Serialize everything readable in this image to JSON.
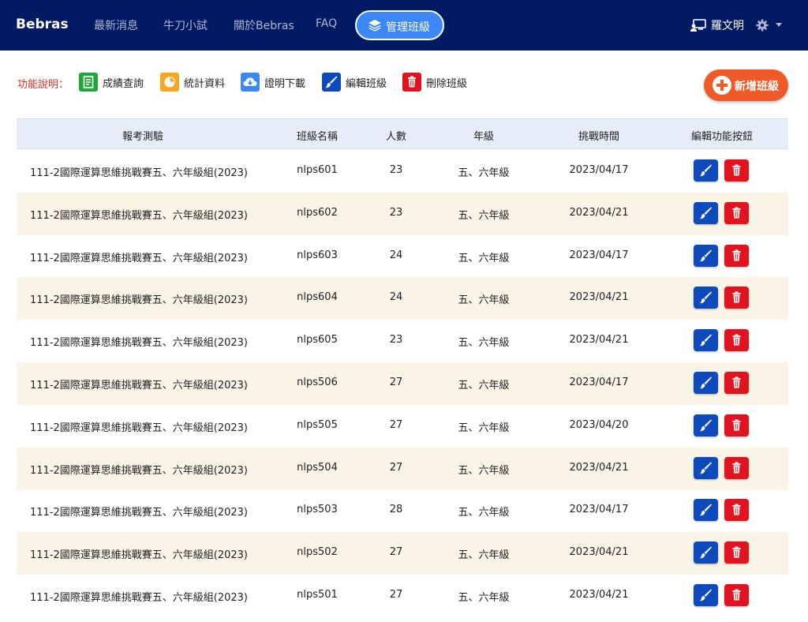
{
  "navbar": {
    "brand": "Bebras",
    "items": [
      {
        "label": "最新消息"
      },
      {
        "label": "牛刀小試"
      },
      {
        "label": "關於Bebras"
      },
      {
        "label": "FAQ"
      }
    ],
    "active_item": {
      "label": "管理班級",
      "icon": "layers-icon"
    },
    "user": {
      "name": "羅文明",
      "icon": "chalkboard-user-icon"
    },
    "settings_icon": "gear-icon"
  },
  "legend": {
    "label": "功能說明：",
    "items": [
      {
        "label": "成績查詢",
        "icon": "grade-sheet-icon",
        "color": "#22a83a"
      },
      {
        "label": "統計資料",
        "icon": "pie-chart-icon",
        "color": "#f6a823"
      },
      {
        "label": "證明下載",
        "icon": "cloud-download-icon",
        "color": "#3b87f7"
      },
      {
        "label": "編輯班級",
        "icon": "brush-icon",
        "color": "#0d4bbd"
      },
      {
        "label": "刪除班級",
        "icon": "trash-icon",
        "color": "#e0131f"
      }
    ]
  },
  "add_button": {
    "label": "新增班級",
    "icon": "plus-circle-icon",
    "color": "#f05a28"
  },
  "table": {
    "headers": {
      "exam": "報考測驗",
      "class_name": "班級名稱",
      "count": "人數",
      "grade": "年級",
      "date": "挑戰時間",
      "actions": "編輯功能按鈕"
    },
    "rows": [
      {
        "exam": "111-2國際運算思維挑戰賽五、六年級組(2023)",
        "class_name": "nlps601",
        "count": "23",
        "grade": "五、六年級",
        "date": "2023/04/17"
      },
      {
        "exam": "111-2國際運算思維挑戰賽五、六年級組(2023)",
        "class_name": "nlps602",
        "count": "23",
        "grade": "五、六年級",
        "date": "2023/04/21"
      },
      {
        "exam": "111-2國際運算思維挑戰賽五、六年級組(2023)",
        "class_name": "nlps603",
        "count": "24",
        "grade": "五、六年級",
        "date": "2023/04/17"
      },
      {
        "exam": "111-2國際運算思維挑戰賽五、六年級組(2023)",
        "class_name": "nlps604",
        "count": "24",
        "grade": "五、六年級",
        "date": "2023/04/21"
      },
      {
        "exam": "111-2國際運算思維挑戰賽五、六年級組(2023)",
        "class_name": "nlps605",
        "count": "23",
        "grade": "五、六年級",
        "date": "2023/04/21"
      },
      {
        "exam": "111-2國際運算思維挑戰賽五、六年級組(2023)",
        "class_name": "nlps506",
        "count": "27",
        "grade": "五、六年級",
        "date": "2023/04/17"
      },
      {
        "exam": "111-2國際運算思維挑戰賽五、六年級組(2023)",
        "class_name": "nlps505",
        "count": "27",
        "grade": "五、六年級",
        "date": "2023/04/20"
      },
      {
        "exam": "111-2國際運算思維挑戰賽五、六年級組(2023)",
        "class_name": "nlps504",
        "count": "27",
        "grade": "五、六年級",
        "date": "2023/04/21"
      },
      {
        "exam": "111-2國際運算思維挑戰賽五、六年級組(2023)",
        "class_name": "nlps503",
        "count": "28",
        "grade": "五、六年級",
        "date": "2023/04/17"
      },
      {
        "exam": "111-2國際運算思維挑戰賽五、六年級組(2023)",
        "class_name": "nlps502",
        "count": "27",
        "grade": "五、六年級",
        "date": "2023/04/21"
      },
      {
        "exam": "111-2國際運算思維挑戰賽五、六年級組(2023)",
        "class_name": "nlps501",
        "count": "27",
        "grade": "五、六年級",
        "date": "2023/04/21"
      }
    ],
    "row_actions": {
      "edit_icon": "brush-icon",
      "delete_icon": "trash-icon"
    }
  },
  "colors": {
    "navbar_bg": "#011a63",
    "active_pill": "#3b87f7",
    "header_bg": "#e6ecf8",
    "alt_row_bg": "#faf4e7",
    "legend_label": "#d9302a"
  }
}
